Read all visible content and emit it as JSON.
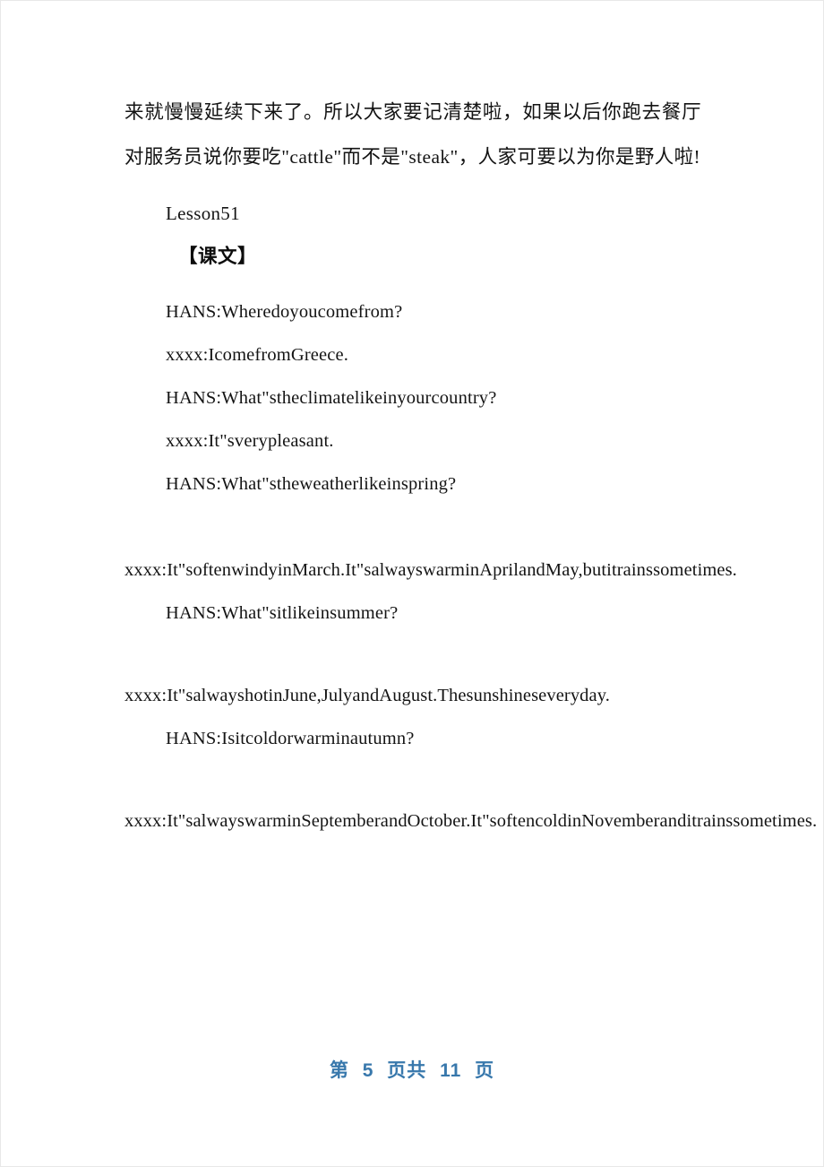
{
  "document": {
    "body_paragraph_cn": "来就慢慢延续下来了。所以大家要记清楚啦，如果以后你跑去餐厅对服务员说你要吃\"cattle\"而不是\"steak\"，人家可要以为你是野人啦!",
    "lesson_title": "Lesson51",
    "section_heading": "【课文】",
    "dialogue": [
      {
        "speaker_line": "HANS:Wheredoyoucomefrom?",
        "style": "indent"
      },
      {
        "speaker_line": "xxxx:IcomefromGreece.",
        "style": "indent"
      },
      {
        "speaker_line": "HANS:What\"stheclimatelikeinyourcountry?",
        "style": "indent"
      },
      {
        "speaker_line": "xxxx:It\"sverypleasant.",
        "style": "indent"
      },
      {
        "speaker_line": "HANS:What\"stheweatherlikeinspring?",
        "style": "indent"
      },
      {
        "speaker_line": "xxxx:It\"softenwindyinMarch.It\"salwayswarminAprilandMay,butitrainssometimes.",
        "style": "wrap"
      },
      {
        "speaker_line": "HANS:What\"sitlikeinsummer?",
        "style": "indent"
      },
      {
        "speaker_line": "xxxx:It\"salwayshotinJune,JulyandAugust.Thesunshineseveryday.",
        "style": "wrap"
      },
      {
        "speaker_line": "HANS:Isitcoldorwarminautumn?",
        "style": "indent"
      },
      {
        "speaker_line": "xxxx:It\"salwayswarminSeptemberandOctober.It\"softencoldinNovemberanditrainssometimes.",
        "style": "wrap"
      }
    ]
  },
  "footer": {
    "prefix": "第",
    "current_page": "5",
    "middle": "页共",
    "total_pages": "11",
    "suffix": "页",
    "color": "#3878ac"
  }
}
